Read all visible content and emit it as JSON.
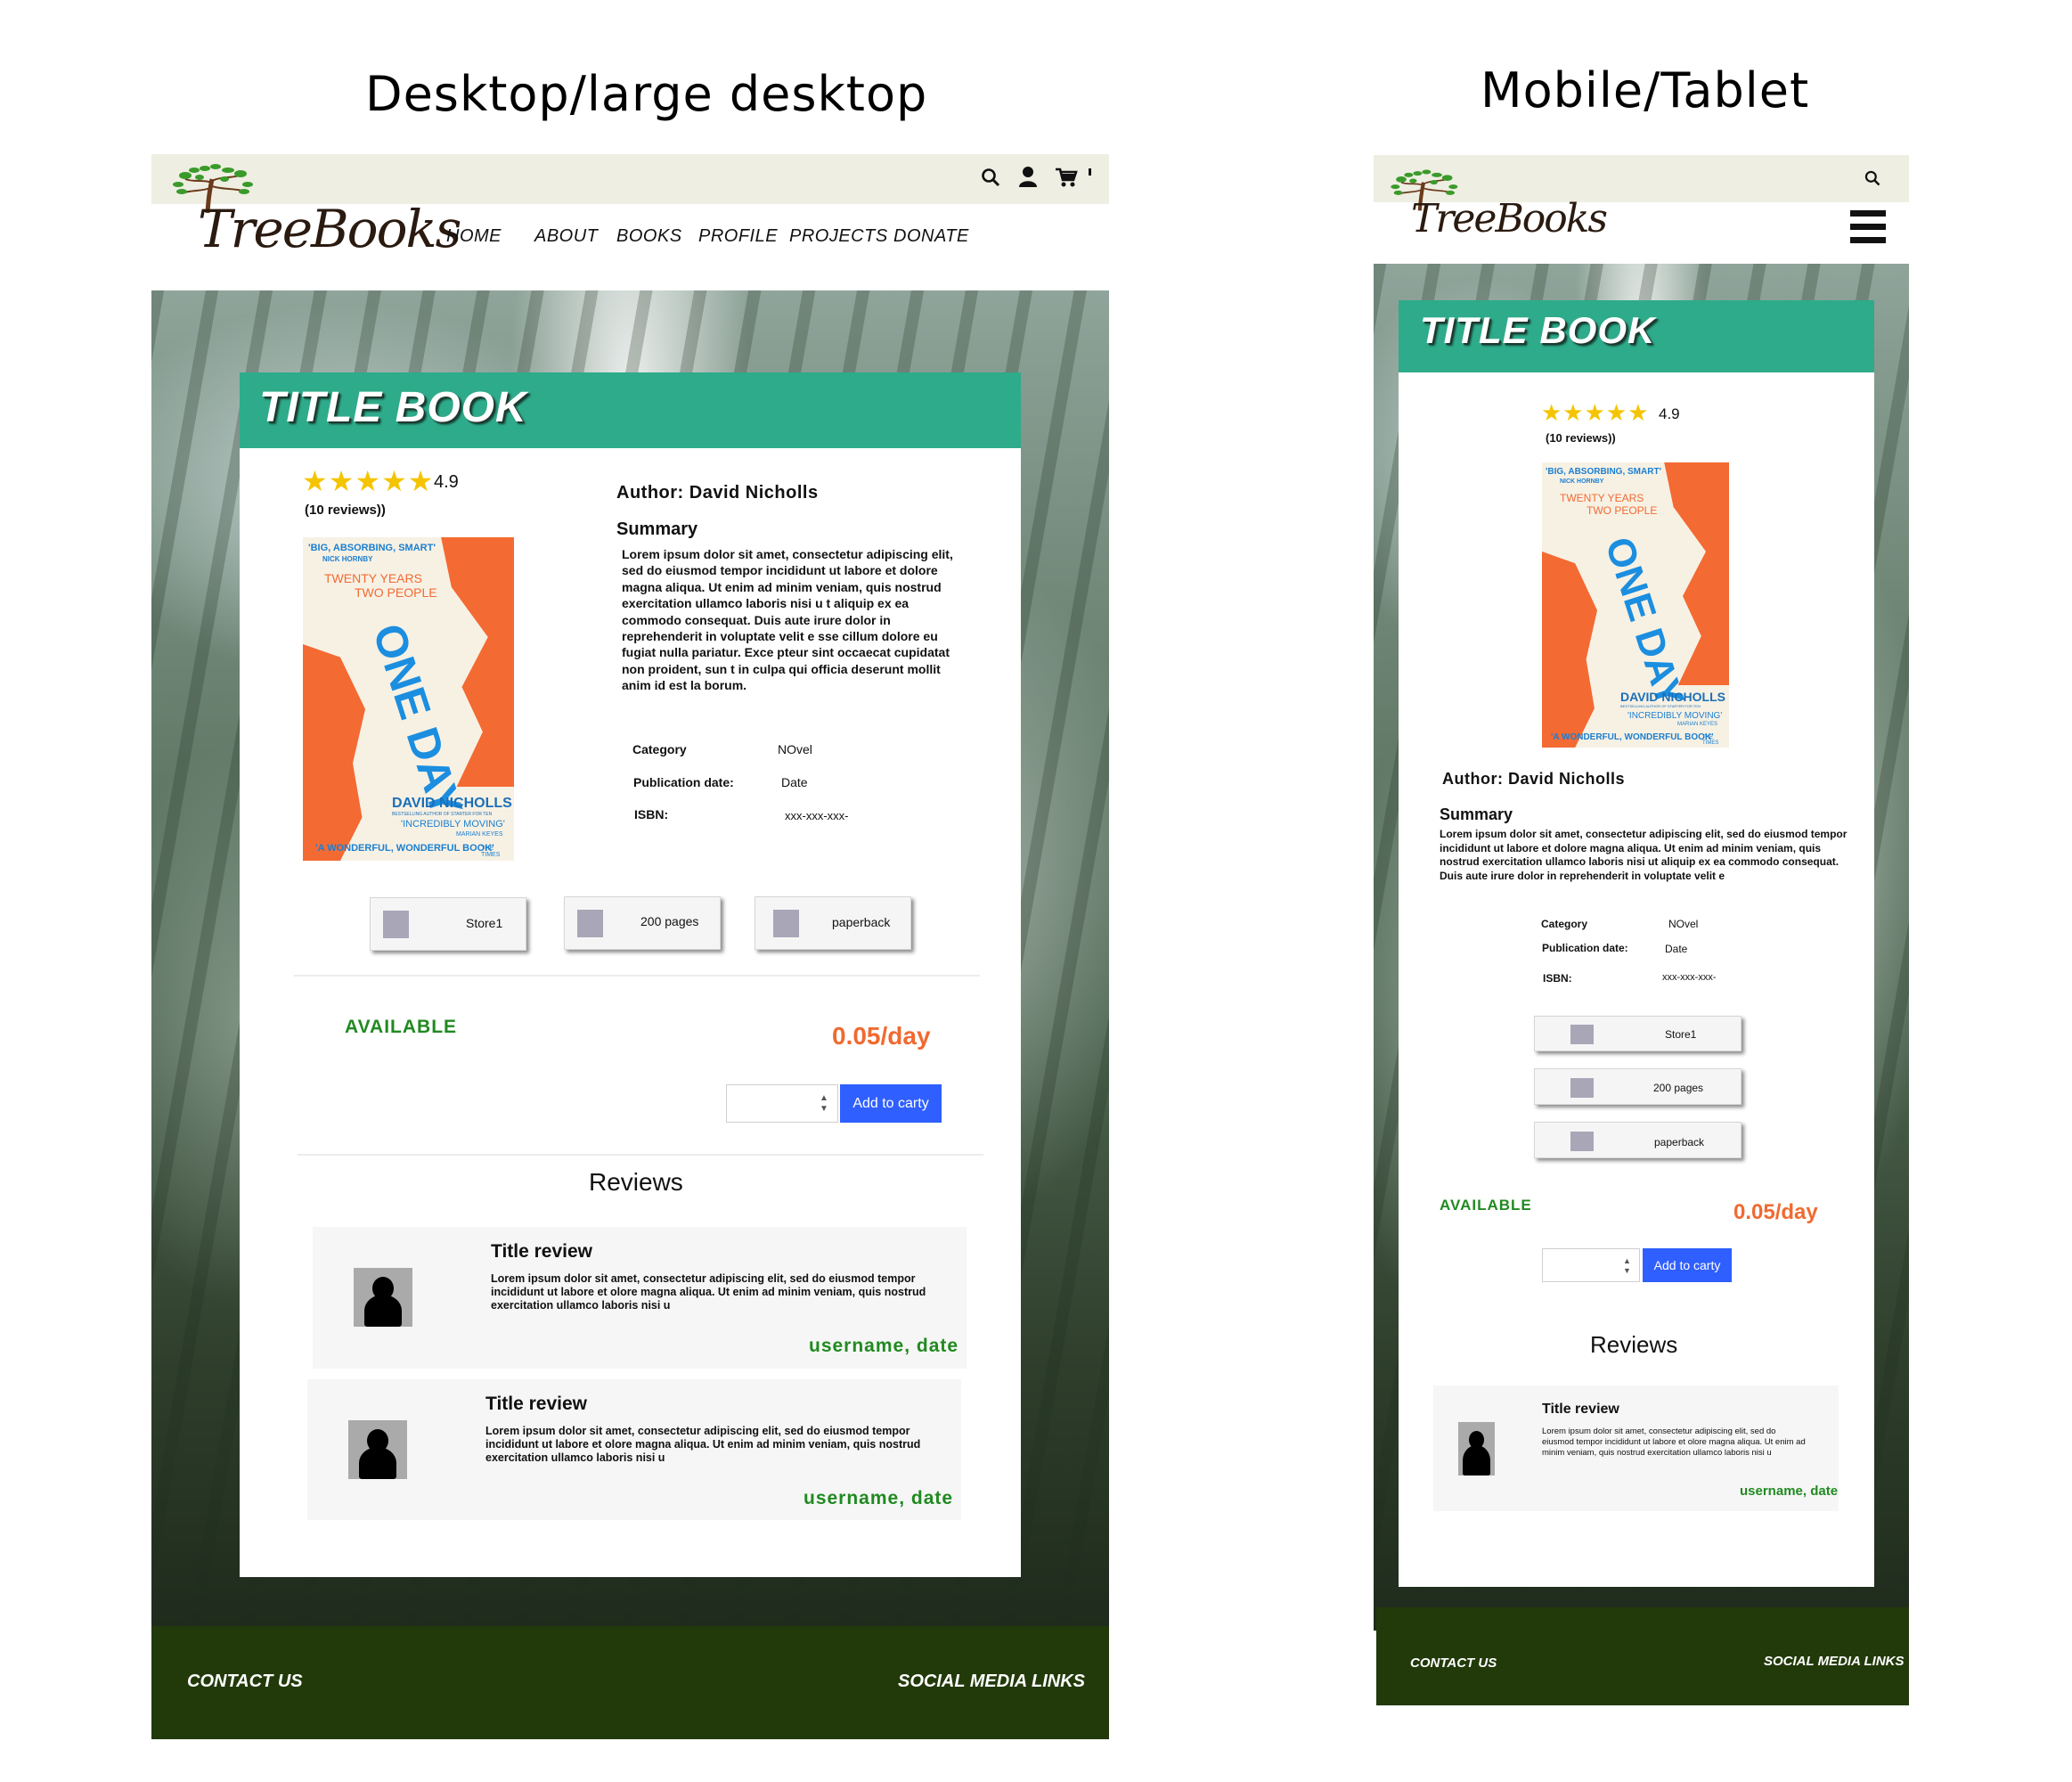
{
  "headings": {
    "desktop": "Desktop/large desktop",
    "mobile": "Mobile/Tablet"
  },
  "brand": {
    "logo_text": "TreeBooks"
  },
  "nav": {
    "home": "HOME",
    "about": "ABOUT",
    "books": "BOOKS",
    "profile": "PROFILE",
    "projects": "PROJECTS",
    "donate": "DONATE"
  },
  "book": {
    "title": "TITLE BOOK",
    "stars": "★★★★★",
    "rating": "4.9",
    "reviews_count": "(10 reviews))",
    "author": "Author: David Nicholls",
    "summary_heading": "Summary",
    "summary_desktop": "Lorem ipsum dolor sit amet, consectetur adipiscing elit, sed do eiusmod tempor incididunt ut labore et dolore magna aliqua. Ut enim ad minim veniam, quis nostrud exercitation ullamco laboris nisi u t aliquip ex ea commodo consequat. Duis aute irure dolor in reprehenderit in voluptate velit e sse cillum dolore eu fugiat nulla pariatur. Exce pteur sint occaecat cupidatat non proident, sun t in culpa qui officia deserunt mollit anim id est la borum.",
    "summary_mobile": "Lorem ipsum dolor sit amet, consectetur adipiscing elit, sed do eiusmod tempor incididunt ut labore et dolore magna aliqua. Ut enim ad minim veniam, quis nostrud exercitation ullamco laboris nisi ut aliquip ex ea commodo consequat. Duis aute irure dolor in reprehenderit in voluptate velit e",
    "details": {
      "category_label": "Category",
      "category_value": "NOvel",
      "pubdate_label": "Publication date:",
      "pubdate_value": "Date",
      "isbn_label": "ISBN:",
      "isbn_value": "xxx-xxx-xxx-"
    },
    "features": {
      "store": "Store1",
      "pages": "200 pages",
      "format": "paperback"
    },
    "availability": "AVAILABLE",
    "price": "0.05/day",
    "add_to_cart": "Add to carty",
    "quantity_stepper": "▲\n▼"
  },
  "cover": {
    "quote1": "'BIG, ABSORBING, SMART'",
    "quote1_src": "NICK HORNBY",
    "tagline1": "TWENTY YEARS",
    "tagline2": "TWO PEOPLE",
    "title": "ONE DAY",
    "author": "DAVID NICHOLLS",
    "author_sub": "BESTSELLING AUTHOR OF STARTER FOR TEN",
    "quote2": "'INCREDIBLY MOVING'",
    "quote2_src": "MARIAN KEYES",
    "quote3": "'A WONDERFUL, WONDERFUL BOOK'",
    "quote3_src": "THE TIMES"
  },
  "reviews": {
    "heading": "Reviews",
    "items": [
      {
        "title": "Title review",
        "text": "Lorem ipsum dolor sit amet, consectetur adipiscing elit, sed do eiusmod tempor incididunt ut labore et olore magna aliqua. Ut enim ad minim veniam, quis nostrud exercitation ullamco laboris nisi u",
        "user": "username, date"
      },
      {
        "title": "Title review",
        "text": "Lorem ipsum dolor sit amet, consectetur adipiscing elit, sed do eiusmod tempor incididunt ut labore et olore magna aliqua. Ut enim ad minim veniam, quis nostrud exercitation ullamco laboris nisi u",
        "user": "username, date"
      }
    ]
  },
  "footer": {
    "contact": "CONTACT US",
    "social": "SOCIAL MEDIA LINKS"
  },
  "icons": {
    "search": "search-icon",
    "user": "user-icon",
    "cart": "cart-icon",
    "menu": "hamburger-menu-icon",
    "logo": "tree-logo-icon"
  },
  "colors": {
    "brand_green": "#2eab8a",
    "footer_green": "#223a0a",
    "available_green": "#208a20",
    "price_orange": "#f06a30",
    "cart_blue": "#2f5fff",
    "topbar": "#eeeee2"
  }
}
